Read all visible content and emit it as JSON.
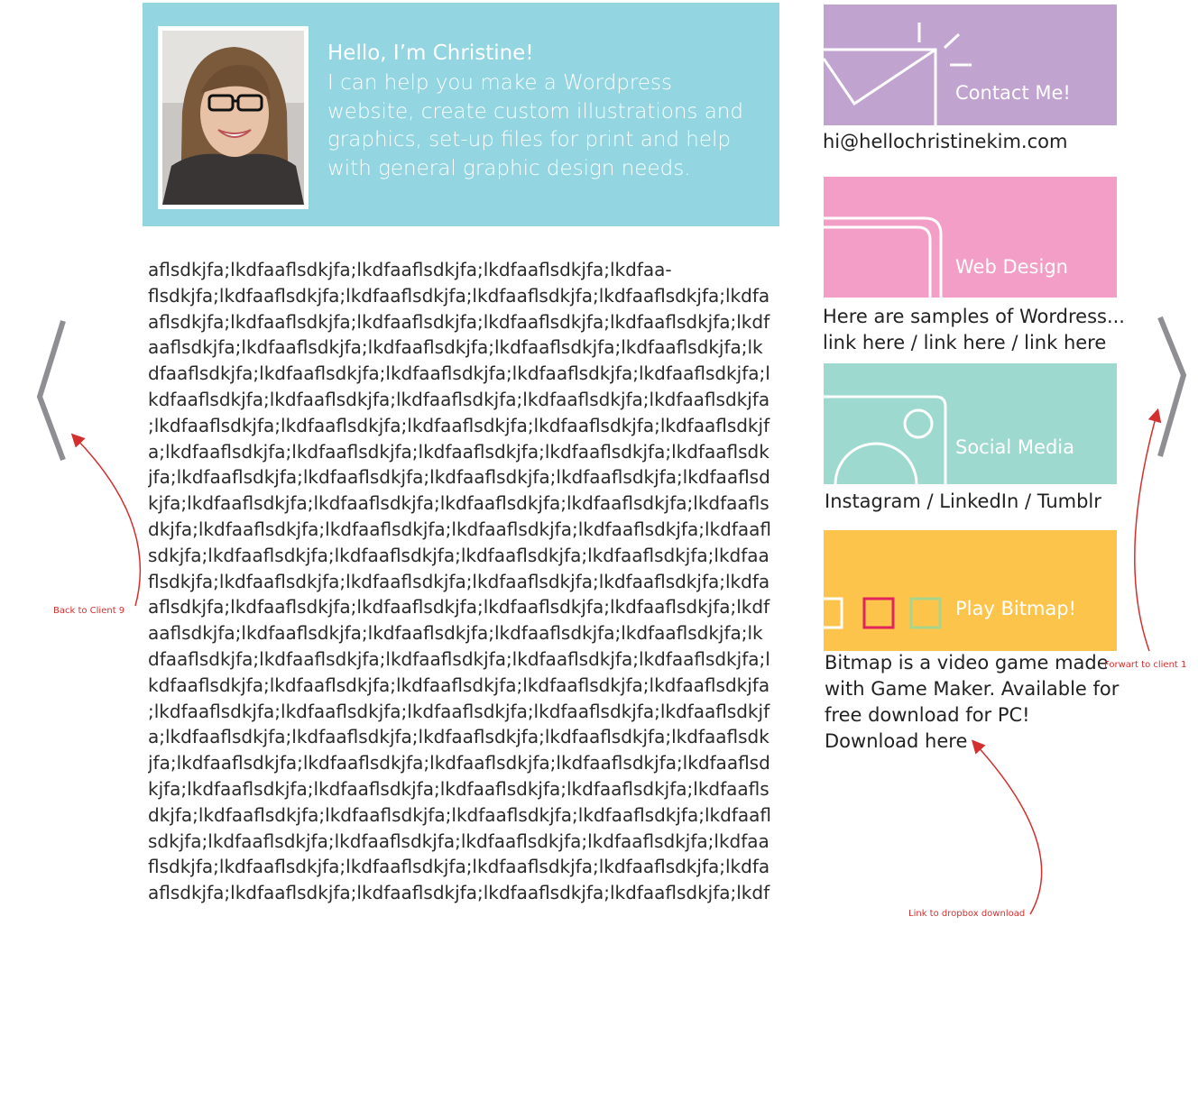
{
  "hero": {
    "heading": "Hello, I’m Christine!",
    "body": "I can help you make a Wordpress website, create custom illustrations and graphics, set-up files for print and help with general graphic design needs.",
    "bg_color": "#93d6e1"
  },
  "lorem_lines": [
    "aflsdkjfa;lkdfaaflsdkjfa;lkdfaaflsdkjfa;lkdfaaflsdkjfa;lkdfaa-",
    "flsdkjfa;lkdfaaflsdkjfa;lkdfaaflsdkjfa;lkdfaaflsdkjfa;lkdfaaflsdkjfa;lkdfa",
    "aflsdkjfa;lkdfaaflsdkjfa;lkdfaaflsdkjfa;lkdfaaflsdkjfa;lkdfaaflsdkjfa;lkdf",
    "aaflsdkjfa;lkdfaaflsdkjfa;lkdfaaflsdkjfa;lkdfaaflsdkjfa;lkdfaaflsdkjfa;lk",
    "dfaaflsdkjfa;lkdfaaflsdkjfa;lkdfaaflsdkjfa;lkdfaaflsdkjfa;lkdfaaflsdkjfa;l",
    "kdfaaflsdkjfa;lkdfaaflsdkjfa;lkdfaaflsdkjfa;lkdfaaflsdkjfa;lkdfaaflsdkjfa",
    ";lkdfaaflsdkjfa;lkdfaaflsdkjfa;lkdfaaflsdkjfa;lkdfaaflsdkjfa;lkdfaaflsdkjf",
    "a;lkdfaaflsdkjfa;lkdfaaflsdkjfa;lkdfaaflsdkjfa;lkdfaaflsdkjfa;lkdfaaflsdk",
    "jfa;lkdfaaflsdkjfa;lkdfaaflsdkjfa;lkdfaaflsdkjfa;lkdfaaflsdkjfa;lkdfaaflsd",
    "kjfa;lkdfaaflsdkjfa;lkdfaaflsdkjfa;lkdfaaflsdkjfa;lkdfaaflsdkjfa;lkdfaafls",
    "dkjfa;lkdfaaflsdkjfa;lkdfaaflsdkjfa;lkdfaaflsdkjfa;lkdfaaflsdkjfa;lkdfaafl",
    "sdkjfa;lkdfaaflsdkjfa;lkdfaaflsdkjfa;lkdfaaflsdkjfa;lkdfaaflsdkjfa;lkdfaa",
    "flsdkjfa;lkdfaaflsdkjfa;lkdfaaflsdkjfa;lkdfaaflsdkjfa;lkdfaaflsdkjfa;lkdfa",
    "aflsdkjfa;lkdfaaflsdkjfa;lkdfaaflsdkjfa;lkdfaaflsdkjfa;lkdfaaflsdkjfa;lkdf",
    "aaflsdkjfa;lkdfaaflsdkjfa;lkdfaaflsdkjfa;lkdfaaflsdkjfa;lkdfaaflsdkjfa;lk",
    "dfaaflsdkjfa;lkdfaaflsdkjfa;lkdfaaflsdkjfa;lkdfaaflsdkjfa;lkdfaaflsdkjfa;l",
    "kdfaaflsdkjfa;lkdfaaflsdkjfa;lkdfaaflsdkjfa;lkdfaaflsdkjfa;lkdfaaflsdkjfa",
    ";lkdfaaflsdkjfa;lkdfaaflsdkjfa;lkdfaaflsdkjfa;lkdfaaflsdkjfa;lkdfaaflsdkjf",
    "a;lkdfaaflsdkjfa;lkdfaaflsdkjfa;lkdfaaflsdkjfa;lkdfaaflsdkjfa;lkdfaaflsdk",
    "jfa;lkdfaaflsdkjfa;lkdfaaflsdkjfa;lkdfaaflsdkjfa;lkdfaaflsdkjfa;lkdfaaflsd",
    "kjfa;lkdfaaflsdkjfa;lkdfaaflsdkjfa;lkdfaaflsdkjfa;lkdfaaflsdkjfa;lkdfaafls",
    "dkjfa;lkdfaaflsdkjfa;lkdfaaflsdkjfa;lkdfaaflsdkjfa;lkdfaaflsdkjfa;lkdfaafl",
    "sdkjfa;lkdfaaflsdkjfa;lkdfaaflsdkjfa;lkdfaaflsdkjfa;lkdfaaflsdkjfa;lkdfaa",
    "flsdkjfa;lkdfaaflsdkjfa;lkdfaaflsdkjfa;lkdfaaflsdkjfa;lkdfaaflsdkjfa;lkdfa",
    "aflsdkjfa;lkdfaaflsdkjfa;lkdfaaflsdkjfa;lkdfaaflsdkjfa;lkdfaaflsdkjfa;lkdf"
  ],
  "cards": {
    "contact": {
      "label": "Contact Me!",
      "icon": "envelope-icon",
      "color": "#c1a3cf",
      "text": "hi@hellochristinekim.com"
    },
    "web": {
      "label": "Web Design",
      "icon": "browser-window-icon",
      "color": "#f29ec6",
      "text1": "Here are samples of Wordress...",
      "text2": "link here / link here / link here"
    },
    "social": {
      "label": "Social Media",
      "icon": "camera-icon",
      "color": "#9ed9d0",
      "text": "Instagram / LinkedIn / Tumblr"
    },
    "bitmap": {
      "label": "Play Bitmap!",
      "icon": "pixel-squares-icon",
      "color": "#fdc44c",
      "text1": "Bitmap is a video game made",
      "text2": "with Game Maker. Available for",
      "text3": "free download for PC!",
      "text4": "Download here"
    }
  },
  "nav": {
    "prev_icon": "chevron-left-icon",
    "next_icon": "chevron-right-icon",
    "arrow_color": "#8e8e93"
  },
  "annotations": {
    "back": "Back to Client 9",
    "forward": "Forwart to client 1",
    "download": "Link to dropbox download",
    "color": "#d32f2f"
  }
}
